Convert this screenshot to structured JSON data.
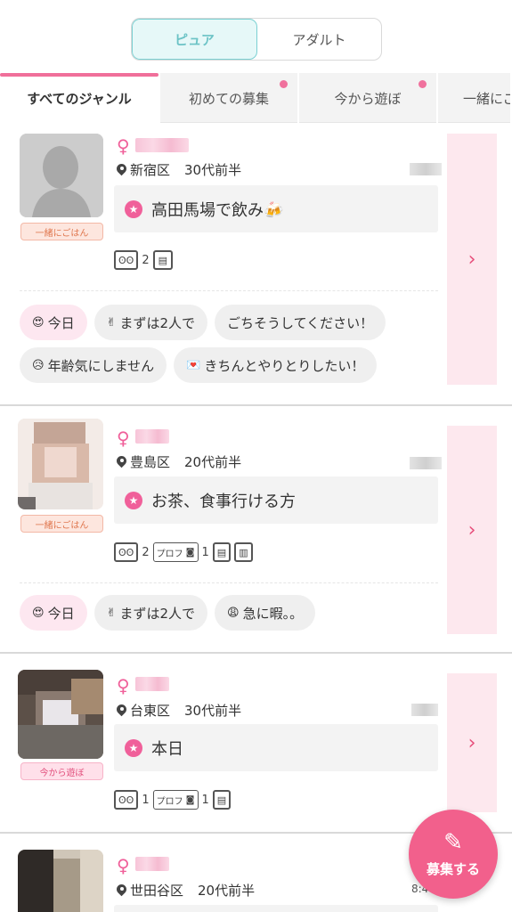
{
  "mode_toggle": {
    "options": [
      "ピュア",
      "アダルト"
    ],
    "selected": "ピュア"
  },
  "tabs": [
    {
      "label": "すべてのジャンル",
      "active": true,
      "dot": false
    },
    {
      "label": "初めての募集",
      "active": false,
      "dot": true
    },
    {
      "label": "今から遊ぼ",
      "active": false,
      "dot": true
    },
    {
      "label": "一緒にご",
      "active": false,
      "dot": false
    }
  ],
  "posts": [
    {
      "avatar_badge": "一緒にごはん",
      "gender_symbol": "♀",
      "location": "新宿区",
      "age": "30代前半",
      "title": "高田馬場で飲み🍻",
      "meta": {
        "footprints": "2",
        "has_profile_photo": false,
        "profile_photo_count": ""
      },
      "tags": [
        {
          "emoji": "😍",
          "label": "今日",
          "highlight": true
        },
        {
          "emoji": "✌",
          "label": "まずは2人で",
          "highlight": false
        },
        {
          "emoji": "",
          "label": "ごちそうしてください！",
          "highlight": false
        },
        {
          "emoji": "😥",
          "label": "年齢気にしません",
          "highlight": false
        },
        {
          "emoji": "💌",
          "label": "きちんとやりとりしたい！",
          "highlight": false
        }
      ]
    },
    {
      "avatar_badge": "一緒にごはん",
      "gender_symbol": "♀",
      "location": "豊島区",
      "age": "20代前半",
      "title": "お茶、食事行ける方",
      "meta": {
        "footprints": "2",
        "profile_label": "プロフ",
        "profile_photo_count": "1"
      },
      "tags": [
        {
          "emoji": "😍",
          "label": "今日",
          "highlight": true
        },
        {
          "emoji": "✌",
          "label": "まずは2人で",
          "highlight": false
        },
        {
          "emoji": "😩",
          "label": "急に暇。。",
          "highlight": false
        }
      ]
    },
    {
      "avatar_badge": "今から遊ぼ",
      "gender_symbol": "♀",
      "location": "台東区",
      "age": "30代前半",
      "title": "本日",
      "meta": {
        "footprints": "1",
        "profile_label": "プロフ",
        "profile_photo_count": "1"
      },
      "tags": []
    },
    {
      "avatar_badge": "",
      "gender_symbol": "♀",
      "location": "世田谷区",
      "age": "20代前半",
      "time": "8:4",
      "title": "",
      "meta": {},
      "tags": []
    }
  ],
  "fab": {
    "label": "募集する"
  },
  "colors": {
    "accent_pink": "#f0609a",
    "teal": "#6cc3c6",
    "arrow_panel": "#fde8ee"
  }
}
